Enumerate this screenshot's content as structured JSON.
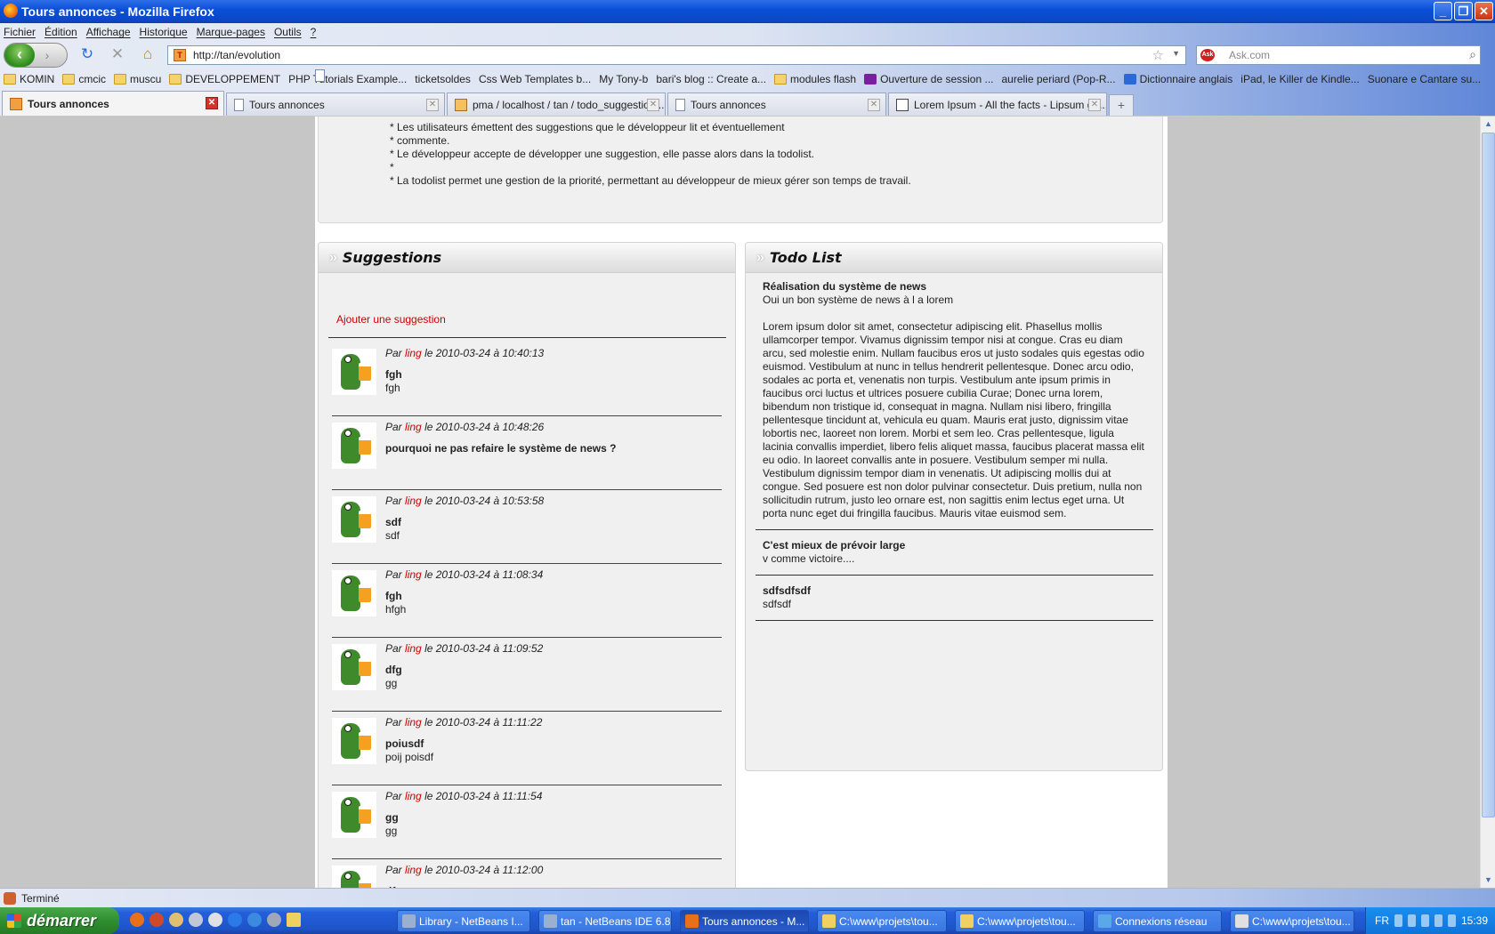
{
  "window": {
    "title": "Tours annonces - Mozilla Firefox",
    "controls": [
      "_",
      "❐",
      "✕"
    ]
  },
  "menu": [
    "Fichier",
    "Édition",
    "Affichage",
    "Historique",
    "Marque-pages",
    "Outils",
    "?"
  ],
  "nav": {
    "url": "http://tan/evolution",
    "search_placeholder": "Ask.com"
  },
  "bookmarks": [
    {
      "label": "KOMIN",
      "icon": "folder"
    },
    {
      "label": "cmcic",
      "icon": "folder"
    },
    {
      "label": "muscu",
      "icon": "folder"
    },
    {
      "label": "DEVELOPPEMENT",
      "icon": "folder"
    },
    {
      "label": "PHP Tutorials Example...",
      "icon": "page"
    },
    {
      "label": "ticketsoldes",
      "icon": "page"
    },
    {
      "label": "Css Web Templates b...",
      "icon": "page"
    },
    {
      "label": "My Tony-b",
      "icon": "page"
    },
    {
      "label": "bari's blog :: Create a...",
      "icon": "page"
    },
    {
      "label": "modules flash",
      "icon": "folder"
    },
    {
      "label": "Ouverture de session ...",
      "icon": "yahoo"
    },
    {
      "label": "aurelie periard (Pop-R...",
      "icon": "page"
    },
    {
      "label": "Dictionnaire anglais",
      "icon": "wr"
    },
    {
      "label": "iPad, le Killer de Kindle...",
      "icon": "page"
    },
    {
      "label": "Suonare e Cantare su...",
      "icon": "page"
    }
  ],
  "tabs": [
    {
      "label": "Tours annonces",
      "icon": "ts",
      "active": true
    },
    {
      "label": "Tours annonces",
      "icon": "pg",
      "active": false
    },
    {
      "label": "pma / localhost / tan / todo_suggestion...",
      "icon": "pma",
      "active": false
    },
    {
      "label": "Tours annonces",
      "icon": "pg",
      "active": false
    },
    {
      "label": "Lorem Ipsum - All the facts - Lipsum ge...",
      "icon": "lo",
      "active": false
    }
  ],
  "intro": [
    "* Les utilisateurs émettent des suggestions que le développeur lit et éventuellement",
    "* commente.",
    "* Le développeur accepte de développer une suggestion, elle passe alors dans la todolist.",
    "*",
    "* La todolist permet une gestion de la priorité, permettant au développeur de mieux gérer son temps de travail."
  ],
  "suggestions": {
    "heading": "Suggestions",
    "add_link": "Ajouter une suggestion",
    "items": [
      {
        "by": "Par",
        "user": "ling",
        "date": "le 2010-03-24 à 10:40:13",
        "title": "fgh",
        "text": "fgh"
      },
      {
        "by": "Par",
        "user": "ling",
        "date": "le 2010-03-24 à 10:48:26",
        "title": "pourquoi ne pas refaire le système de news ?",
        "text": ""
      },
      {
        "by": "Par",
        "user": "ling",
        "date": "le 2010-03-24 à 10:53:58",
        "title": "sdf",
        "text": "sdf"
      },
      {
        "by": "Par",
        "user": "ling",
        "date": "le 2010-03-24 à 11:08:34",
        "title": "fgh",
        "text": "hfgh"
      },
      {
        "by": "Par",
        "user": "ling",
        "date": "le 2010-03-24 à 11:09:52",
        "title": "dfg",
        "text": "gg"
      },
      {
        "by": "Par",
        "user": "ling",
        "date": "le 2010-03-24 à 11:11:22",
        "title": "poiusdf",
        "text": "poij poisdf"
      },
      {
        "by": "Par",
        "user": "ling",
        "date": "le 2010-03-24 à 11:11:54",
        "title": "gg",
        "text": "gg"
      },
      {
        "by": "Par",
        "user": "ling",
        "date": "le 2010-03-24 à 11:12:00",
        "title": "dfg",
        "text": ""
      }
    ]
  },
  "todo": {
    "heading": "Todo List",
    "items": [
      {
        "title": "Réalisation du système de news",
        "paragraphs": [
          "Oui un bon système de news à l a lorem",
          "Lorem ipsum dolor sit amet, consectetur adipiscing elit. Phasellus mollis ullamcorper tempor. Vivamus dignissim tempor nisi at congue. Cras eu diam arcu, sed molestie enim. Nullam faucibus eros ut justo sodales quis egestas odio euismod. Vestibulum at nunc in tellus hendrerit pellentesque. Donec arcu odio, sodales ac porta et, venenatis non turpis. Vestibulum ante ipsum primis in faucibus orci luctus et ultrices posuere cubilia Curae; Donec urna lorem, bibendum non tristique id, consequat in magna. Nullam nisi libero, fringilla pellentesque tincidunt at, vehicula eu quam. Mauris erat justo, dignissim vitae lobortis nec, laoreet non lorem. Morbi et sem leo. Cras pellentesque, ligula lacinia convallis imperdiet, libero felis aliquet massa, faucibus placerat massa elit eu odio. In laoreet convallis ante in posuere. Vestibulum semper mi nulla. Vestibulum dignissim tempor diam in venenatis. Ut adipiscing mollis dui at congue. Sed posuere est non dolor pulvinar consectetur. Duis pretium, nulla non sollicitudin rutrum, justo leo ornare est, non sagittis enim lectus eget urna. Ut porta nunc eget dui fringilla faucibus. Mauris vitae euismod sem."
        ]
      },
      {
        "title": "C'est mieux de prévoir large",
        "paragraphs": [
          "v comme victoire...."
        ]
      },
      {
        "title": "sdfsdfsdf",
        "paragraphs": [
          "sdfsdf"
        ]
      }
    ]
  },
  "status": "Terminé",
  "taskbar": {
    "start": "démarrer",
    "tasks": [
      {
        "label": "Library - NetBeans I...",
        "active": false
      },
      {
        "label": "tan - NetBeans IDE 6.8",
        "active": false
      },
      {
        "label": "Tours annonces - M...",
        "active": true
      },
      {
        "label": "C:\\www\\projets\\tou...",
        "active": false
      },
      {
        "label": "C:\\www\\projets\\tou...",
        "active": false
      },
      {
        "label": "Connexions réseau",
        "active": false
      },
      {
        "label": "C:\\www\\projets\\tou...",
        "active": false
      }
    ],
    "lang": "FR",
    "clock": "15:39"
  }
}
